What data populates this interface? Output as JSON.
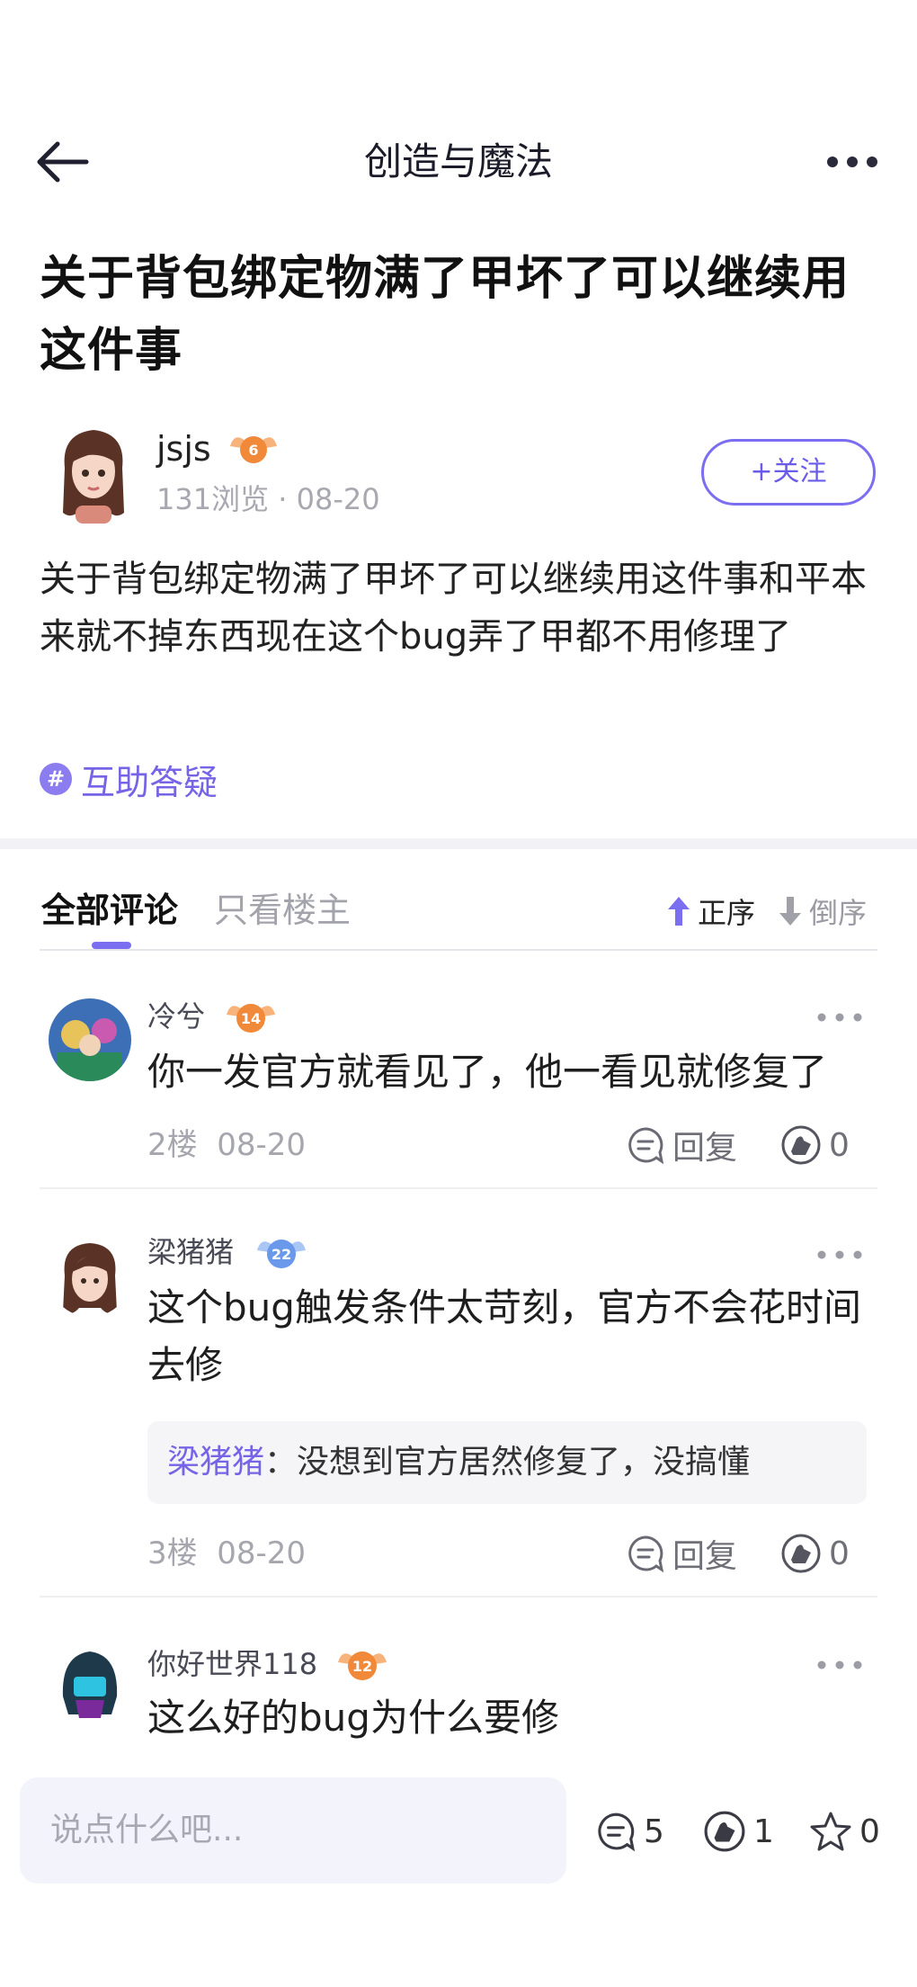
{
  "header": {
    "title": "创造与魔法"
  },
  "post": {
    "title": "关于背包绑定物满了甲坏了可以继续用这件事",
    "author": "jsjs",
    "author_level": "6",
    "views": "131浏览",
    "date": "08-20",
    "follow_label": "+关注",
    "body": "关于背包绑定物满了甲坏了可以继续用这件事和平本来就不掉东西现在这个bug弄了甲都不用修理了",
    "topic": "互助答疑"
  },
  "comments_tabs": {
    "all": "全部评论",
    "op_only": "只看楼主",
    "sort_asc": "正序",
    "sort_desc": "倒序"
  },
  "comments": [
    {
      "name": "冷兮",
      "level": "14",
      "text": "你一发官方就看见了，他一看见就修复了",
      "floor": "2楼",
      "date": "08-20",
      "reply_label": "回复",
      "likes": "0"
    },
    {
      "name": "梁猪猪",
      "level": "22",
      "text": "这个bug触发条件太苛刻，官方不会花时间去修",
      "reply_name": "梁猪猪",
      "reply_colon": "：",
      "reply_text": "没想到官方居然修复了，没搞懂",
      "floor": "3楼",
      "date": "08-20",
      "reply_label": "回复",
      "likes": "0"
    },
    {
      "name": "你好世界118",
      "level": "12",
      "text": "这么好的bug为什么要修"
    }
  ],
  "bottom_bar": {
    "input_placeholder": "说点什么吧...",
    "comments_count": "5",
    "likes_count": "1",
    "favorites_count": "0"
  },
  "colors": {
    "accent": "#7b6ef0",
    "badge_orange": "#f3a25a",
    "badge_blue": "#7aa6f0"
  }
}
